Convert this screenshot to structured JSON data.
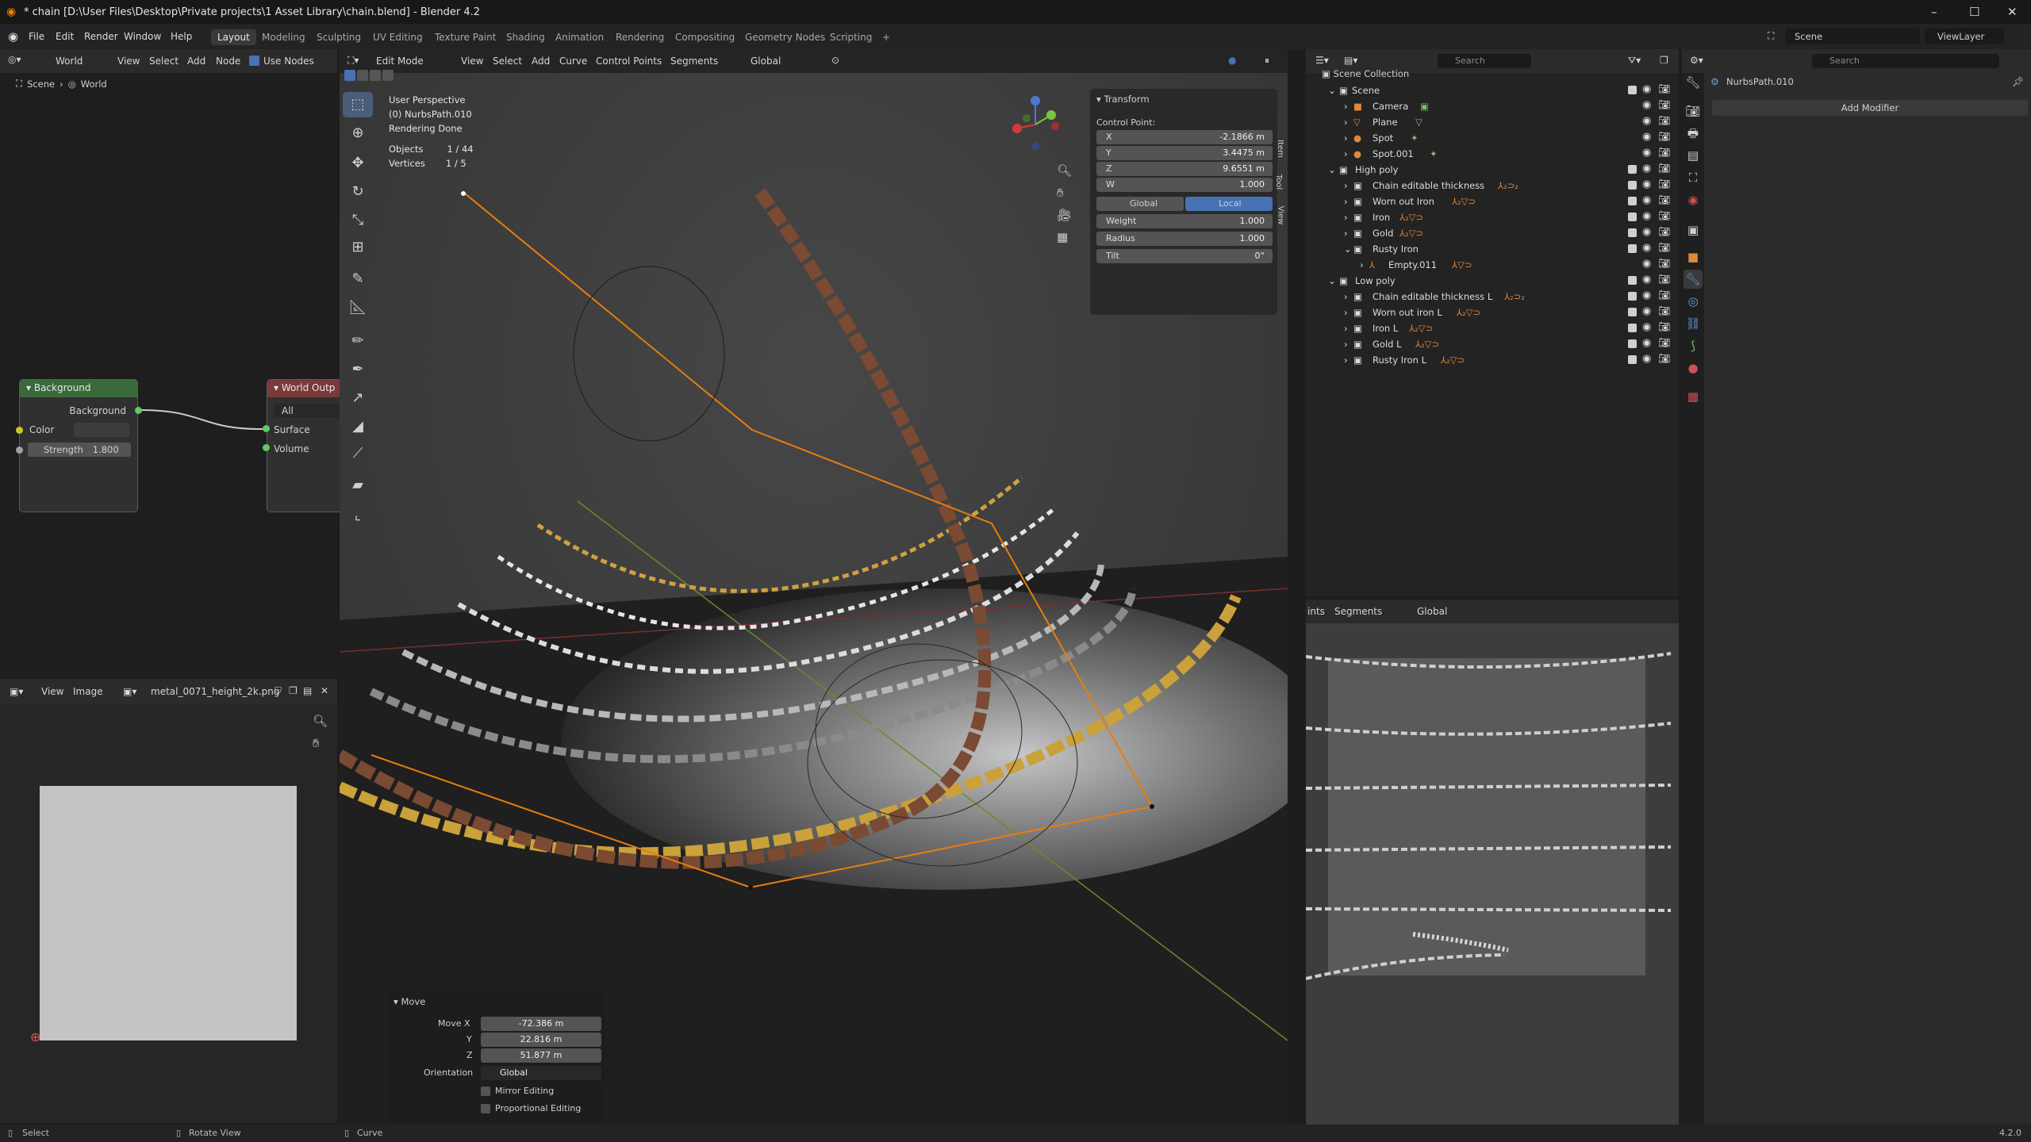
{
  "window": {
    "title": "* chain [D:\\User Files\\Desktop\\Private projects\\1 Asset Library\\chain.blend] - Blender 4.2",
    "min": "–",
    "max": "☐",
    "close": "✕"
  },
  "menus": [
    "File",
    "Edit",
    "Render",
    "Window",
    "Help"
  ],
  "workspaces": [
    "Layout",
    "Modeling",
    "Sculpting",
    "UV Editing",
    "Texture Paint",
    "Shading",
    "Animation",
    "Rendering",
    "Compositing",
    "Geometry Nodes",
    "Scripting",
    "+"
  ],
  "scene_selector": "Scene",
  "viewlayer_selector": "ViewLayer",
  "node_editor": {
    "world_dropdown": "World",
    "menu": [
      "View",
      "Select",
      "Add",
      "Node"
    ],
    "use_nodes": "Use Nodes",
    "breadcrumb_scene": "Scene",
    "breadcrumb_world": "World",
    "background_node": {
      "title": "Background",
      "output": "Background",
      "color_label": "Color",
      "strength_label": "Strength",
      "strength_value": "1.800"
    },
    "world_output_node": {
      "title": "World Outp",
      "target": "All",
      "surface": "Surface",
      "volume": "Volume"
    }
  },
  "image_editor": {
    "menu": [
      "View",
      "Image"
    ],
    "image_name": "metal_0071_height_2k.png"
  },
  "viewport": {
    "mode": "Edit Mode",
    "menu": [
      "View",
      "Select",
      "Add",
      "Curve",
      "Control Points",
      "Segments"
    ],
    "orientation": "Global",
    "overlay_text": {
      "perspective": "User Perspective",
      "object": "(0) NurbsPath.010",
      "render_status": "Rendering Done",
      "objects_label": "Objects",
      "objects_value": "1 / 44",
      "vertices_label": "Vertices",
      "vertices_value": "1 / 5"
    },
    "side_tabs": [
      "Item",
      "Tool",
      "View"
    ],
    "transform": {
      "title": "Transform",
      "control_point": "Control Point:",
      "rows": [
        {
          "label": "X",
          "value": "-2.1866 m"
        },
        {
          "label": "Y",
          "value": "3.4475 m"
        },
        {
          "label": "Z",
          "value": "9.6551 m"
        },
        {
          "label": "W",
          "value": "1.000"
        }
      ],
      "global": "Global",
      "local": "Local",
      "weight_label": "Weight",
      "weight": "1.000",
      "radius_label": "Radius",
      "radius": "1.000",
      "tilt_label": "Tilt",
      "tilt": "0°"
    },
    "move_panel": {
      "title": "Move",
      "move_x_label": "Move X",
      "move_x": "-72.386 m",
      "y_label": "Y",
      "y": "22.816 m",
      "z_label": "Z",
      "z": "51.877 m",
      "orientation_label": "Orientation",
      "orientation": "Global",
      "mirror": "Mirror Editing",
      "proportional": "Proportional Editing"
    }
  },
  "outliner": {
    "search_placeholder": "Search",
    "root": "Scene Collection",
    "items": [
      {
        "label": "Scene",
        "indent": 0
      },
      {
        "label": "Camera",
        "indent": 1
      },
      {
        "label": "Plane",
        "indent": 1
      },
      {
        "label": "Spot",
        "indent": 1
      },
      {
        "label": "Spot.001",
        "indent": 1
      },
      {
        "label": "High poly",
        "indent": 0
      },
      {
        "label": "Chain editable thickness",
        "indent": 1
      },
      {
        "label": "Worn out Iron",
        "indent": 1
      },
      {
        "label": "Iron",
        "indent": 1
      },
      {
        "label": "Gold",
        "indent": 1
      },
      {
        "label": "Rusty Iron",
        "indent": 1
      },
      {
        "label": "Empty.011",
        "indent": 2
      },
      {
        "label": "Low poly",
        "indent": 0
      },
      {
        "label": "Chain editable thickness L",
        "indent": 1
      },
      {
        "label": "Worn out iron L",
        "indent": 1
      },
      {
        "label": "Iron L",
        "indent": 1
      },
      {
        "label": "Gold L",
        "indent": 1
      },
      {
        "label": "Rusty Iron L",
        "indent": 1
      }
    ]
  },
  "viewport2": {
    "menu": [
      "ints",
      "Segments"
    ],
    "orientation": "Global"
  },
  "properties": {
    "search_placeholder": "Search",
    "object": "NurbsPath.010",
    "add_modifier": "Add Modifier"
  },
  "status": {
    "left": "Select",
    "middle": "Rotate View",
    "right": "Curve",
    "version": "4.2.0"
  }
}
